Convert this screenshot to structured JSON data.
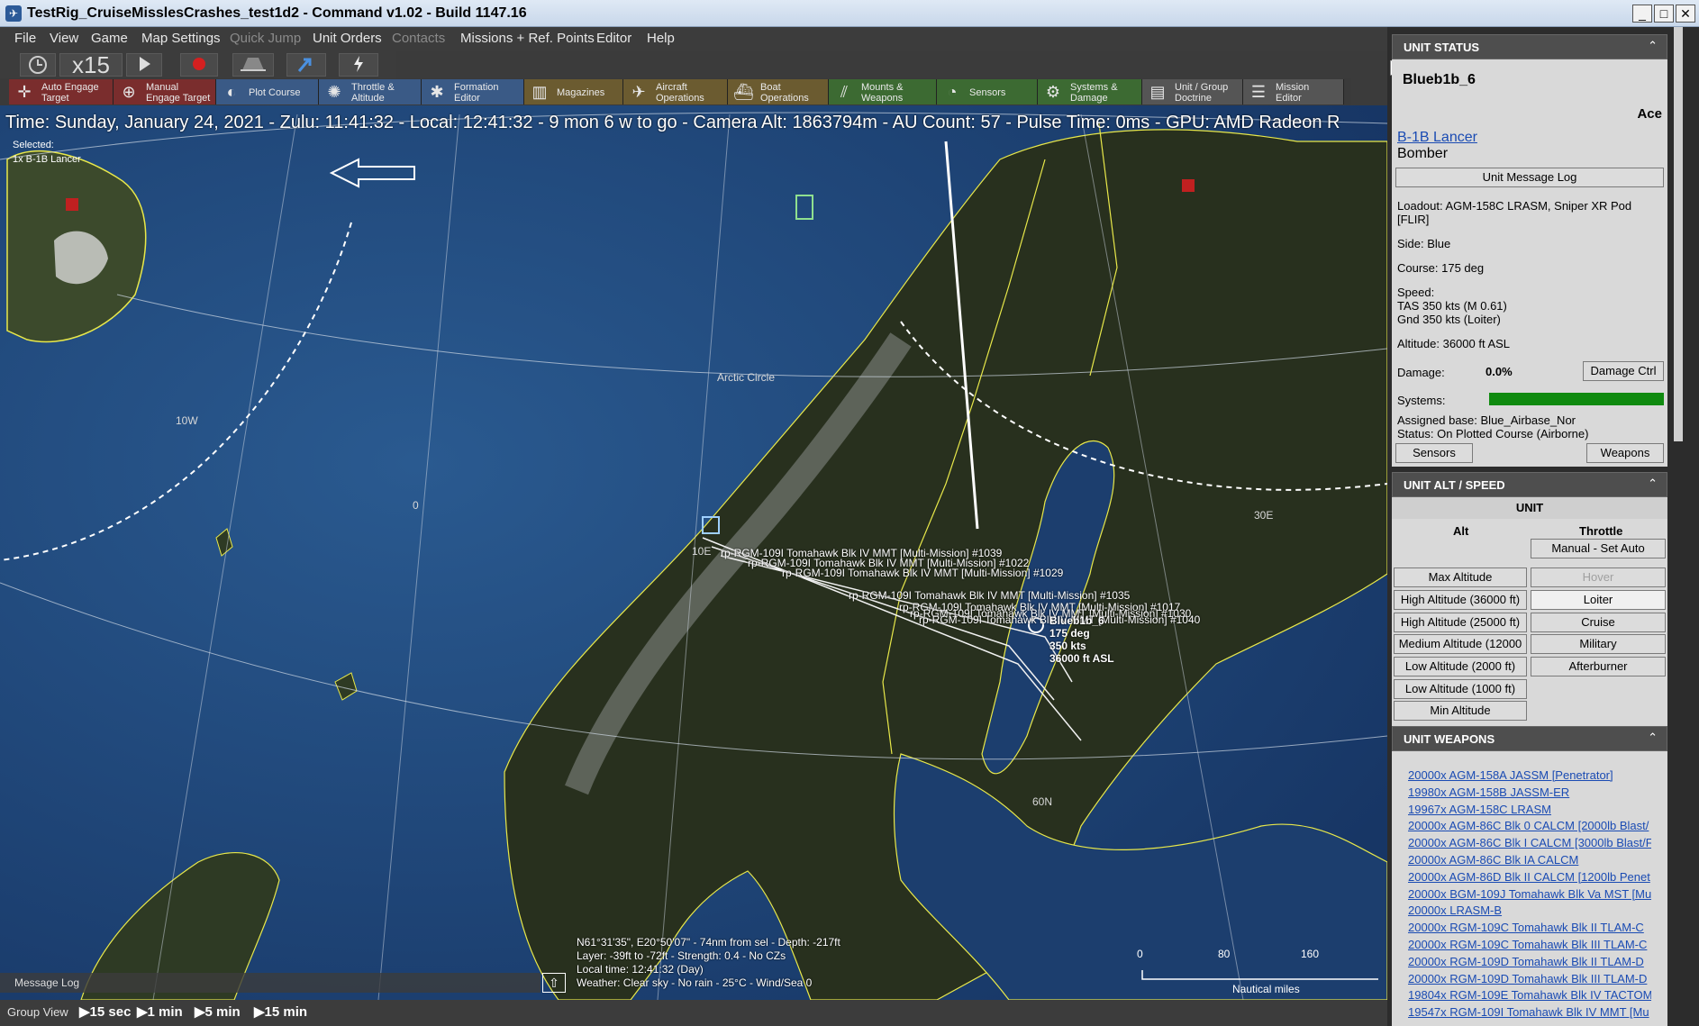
{
  "window": {
    "title": "TestRig_CruiseMisslesCrashes_test1d2 - Command v1.02 - Build 1147.16",
    "min": "_",
    "max": "□",
    "close": "✕"
  },
  "menu": [
    "File",
    "View",
    "Game",
    "Map Settings",
    "Quick Jump",
    "Unit Orders",
    "Contacts",
    "Missions + Ref. Points",
    "Editor",
    "Help"
  ],
  "controls": {
    "time_compression": "x15"
  },
  "toolbar": [
    {
      "label": "Auto Engage\nTarget",
      "icon": "crosshair-icon"
    },
    {
      "label": "Manual\nEngage Target",
      "icon": "target-icon"
    },
    {
      "label": "Plot Course",
      "icon": "compass-icon"
    },
    {
      "label": "Throttle &\nAltitude",
      "icon": "gauge-icon"
    },
    {
      "label": "Formation\nEditor",
      "icon": "formation-icon"
    },
    {
      "label": "Magazines",
      "icon": "magazine-icon"
    },
    {
      "label": "Aircraft\nOperations",
      "icon": "aircraft-icon"
    },
    {
      "label": "Boat\nOperations",
      "icon": "boat-icon"
    },
    {
      "label": "Mounts &\nWeapons",
      "icon": "mounts-icon"
    },
    {
      "label": "Sensors",
      "icon": "sensor-icon"
    },
    {
      "label": "Systems &\nDamage",
      "icon": "gear-icon"
    },
    {
      "label": "Unit / Group\nDoctrine",
      "icon": "doctrine-icon"
    },
    {
      "label": "Mission\nEditor",
      "icon": "mission-icon"
    }
  ],
  "map": {
    "infobar": "Time: Sunday, January 24, 2021 - Zulu: 11:41:32 - Local: 12:41:32 - 9 mon 6 w to go -  Camera Alt: 1863794m  - AU Count: 57 - Pulse Time: 0ms - GPU: AMD Radeon R",
    "selected": "Selected:",
    "selected_unit": "1x B-1B Lancer",
    "labels": {
      "arctic": "Arctic Circle",
      "lon10w": "10W",
      "lon0": "0",
      "lon10e": "10E",
      "lon30e": "30E",
      "lat60n": "60N"
    },
    "tracks": [
      "rp-RGM-109I Tomahawk Blk IV MMT [Multi-Mission] #1039",
      "rp-RGM-109I Tomahawk Blk IV MMT [Multi-Mission] #1022",
      "rp-RGM-109I Tomahawk Blk IV MMT [Multi-Mission] #1029",
      "rp-RGM-109I Tomahawk Blk IV MMT [Multi-Mission] #1035",
      "rp-RGM-109I Tomahawk Blk IV MMT [Multi-Mission] #1017",
      "rp-RGM-109I Tomahawk Blk IV MMT [Multi-Mission] #1030",
      "rp-RGM-109I Tomahawk Blk IV MMT [Multi-Mission] #1040"
    ],
    "unit_tag": {
      "name": "Blueb1b_6",
      "course": "175 deg",
      "speed": "350 kts",
      "alt": "36000 ft ASL"
    },
    "cursor": [
      "N61°31'35\", E20°50'07\" - 74nm from sel - Depth: -217ft",
      "Layer: -39ft to -72ft - Strength: 0.4 - No CZs",
      "Local time: 12:41:32 (Day)",
      "Weather: Clear sky - No rain - 25°C - Wind/Sea 0"
    ],
    "scale": {
      "t0": "0",
      "t80": "80",
      "t160": "160",
      "unit": "Nautical miles"
    },
    "message_log": "Message Log"
  },
  "bottom": {
    "group_view": "Group View",
    "speeds": [
      "15 sec",
      "1 min",
      "5 min",
      "15 min"
    ]
  },
  "panel": {
    "unit_status": {
      "header": "UNIT STATUS",
      "name": "Blueb1b_6",
      "proficiency": "Ace",
      "class_link": "B-1B Lancer",
      "type": "Bomber",
      "msg_log_btn": "Unit Message Log",
      "loadout_1": "Loadout: AGM-158C LRASM, Sniper XR Pod",
      "loadout_2": "[FLIR]",
      "side": "Side: Blue",
      "course": "Course: 175 deg",
      "speed": "Speed:",
      "tas": "TAS 350 kts (M 0.61)",
      "gnd": "Gnd 350 kts (Loiter)",
      "altitude": "Altitude: 36000 ft ASL",
      "damage_lbl": "Damage:",
      "damage_val": "0.0%",
      "damage_btn": "Damage Ctrl",
      "systems_lbl": "Systems:",
      "systems_level": 1.0,
      "base": "Assigned base: Blue_Airbase_Nor",
      "status": "Status: On Plotted Course (Airborne)",
      "sensors_btn": "Sensors",
      "weapons_btn": "Weapons"
    },
    "alt_speed": {
      "header": "UNIT ALT / SPEED",
      "unit": "UNIT",
      "alt_col": "Alt",
      "throttle_col": "Throttle",
      "manual_btn": "Manual - Set Auto",
      "alt_buttons": [
        "Max Altitude",
        "High Altitude (36000 ft)",
        "High Altitude (25000 ft)",
        "Medium Altitude (12000",
        "Low Altitude (2000 ft)",
        "Low Altitude (1000 ft)",
        "Min Altitude"
      ],
      "throttle_buttons": [
        "Hover",
        "Loiter",
        "Cruise",
        "Military",
        "Afterburner"
      ]
    },
    "weapons": {
      "header": "UNIT WEAPONS",
      "items": [
        "20000x AGM-158A JASSM [Penetrator]",
        "19980x AGM-158B JASSM-ER",
        "19967x AGM-158C LRASM",
        "20000x AGM-86C Blk 0 CALCM [2000lb Blast/",
        "20000x AGM-86C Blk I CALCM [3000lb Blast/F",
        "20000x AGM-86C Blk IA CALCM",
        "20000x AGM-86D Blk II CALCM [1200lb Penet",
        "20000x BGM-109J Tomahawk Blk Va MST [Mu",
        "20000x LRASM-B",
        "20000x RGM-109C Tomahawk Blk II TLAM-C",
        "20000x RGM-109C Tomahawk Blk III TLAM-C",
        "20000x RGM-109D Tomahawk Blk II TLAM-D",
        "20000x RGM-109D Tomahawk Blk III TLAM-D",
        "19804x RGM-109E Tomahawk Blk IV TACTOM",
        "19547x RGM-109I Tomahawk Blk IV MMT [Mu"
      ]
    }
  }
}
